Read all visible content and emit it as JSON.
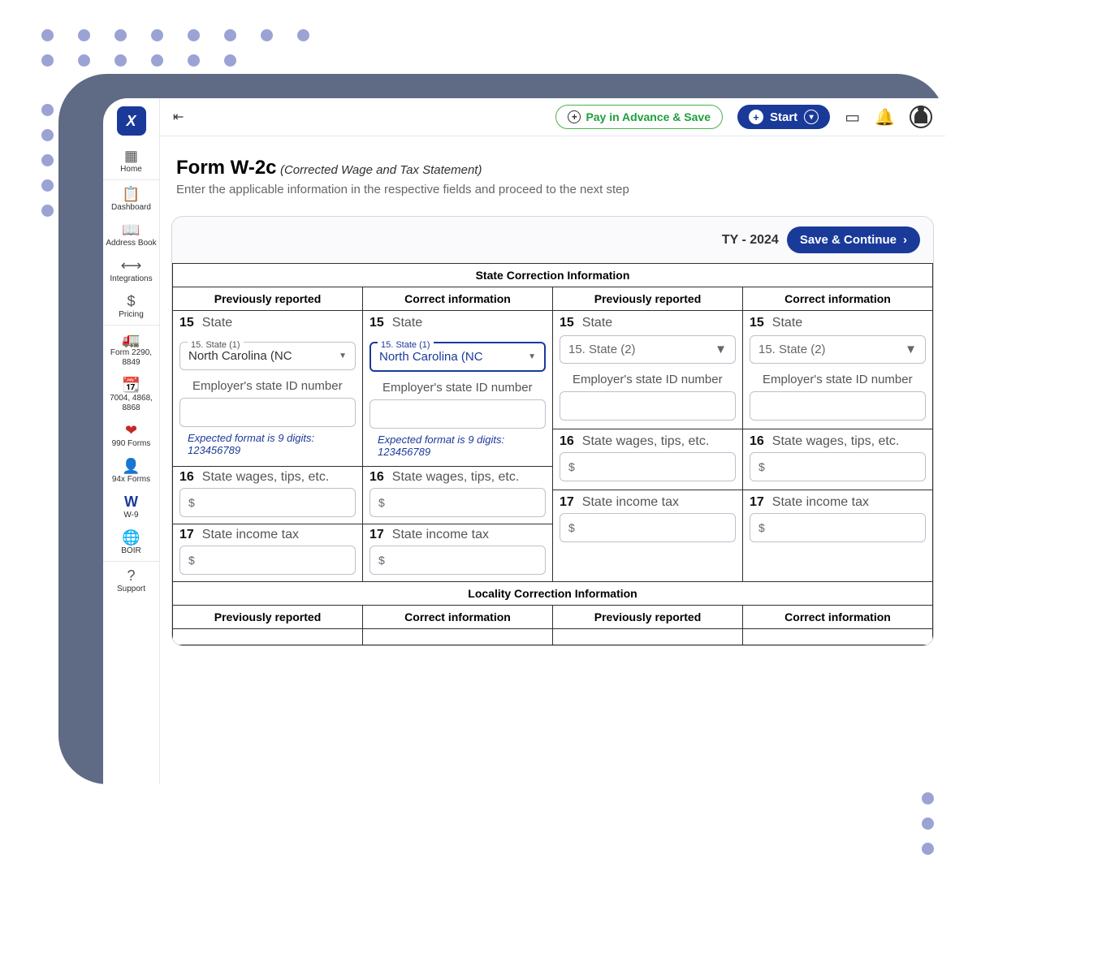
{
  "topbar": {
    "pay_label": "Pay in Advance & Save",
    "start_label": "Start"
  },
  "sidebar": {
    "items": [
      {
        "label": "Home"
      },
      {
        "label": "Dashboard"
      },
      {
        "label": "Address Book"
      },
      {
        "label": "Integrations"
      },
      {
        "label": "Pricing"
      },
      {
        "label": "Form 2290, 8849"
      },
      {
        "label": "7004, 4868, 8868"
      },
      {
        "label": "990 Forms"
      },
      {
        "label": "94x Forms"
      },
      {
        "label": "W-9"
      },
      {
        "label": "BOIR"
      },
      {
        "label": "Support"
      }
    ]
  },
  "page": {
    "title": "Form W-2c",
    "subtitle": "(Corrected Wage and Tax Statement)",
    "desc": "Enter the applicable information in the respective fields and proceed to the next step",
    "ty_label": "TY - 2024",
    "save_continue": "Save & Continue"
  },
  "form": {
    "state_section": "State Correction Information",
    "locality_section": "Locality Correction Information",
    "col_prev": "Previously reported",
    "col_correct": "Correct information",
    "row15": {
      "num": "15",
      "label": "State",
      "state1_legend": "15. State (1)",
      "state1_value": "North Carolina (NC",
      "state2_placeholder": "15. State (2)",
      "employer_id_label": "Employer's state ID number",
      "hint_line1": "Expected format is 9 digits:",
      "hint_line2": "123456789"
    },
    "row16": {
      "num": "16",
      "label": "State wages, tips, etc."
    },
    "row17": {
      "num": "17",
      "label": "State income tax"
    },
    "currency": "$"
  }
}
